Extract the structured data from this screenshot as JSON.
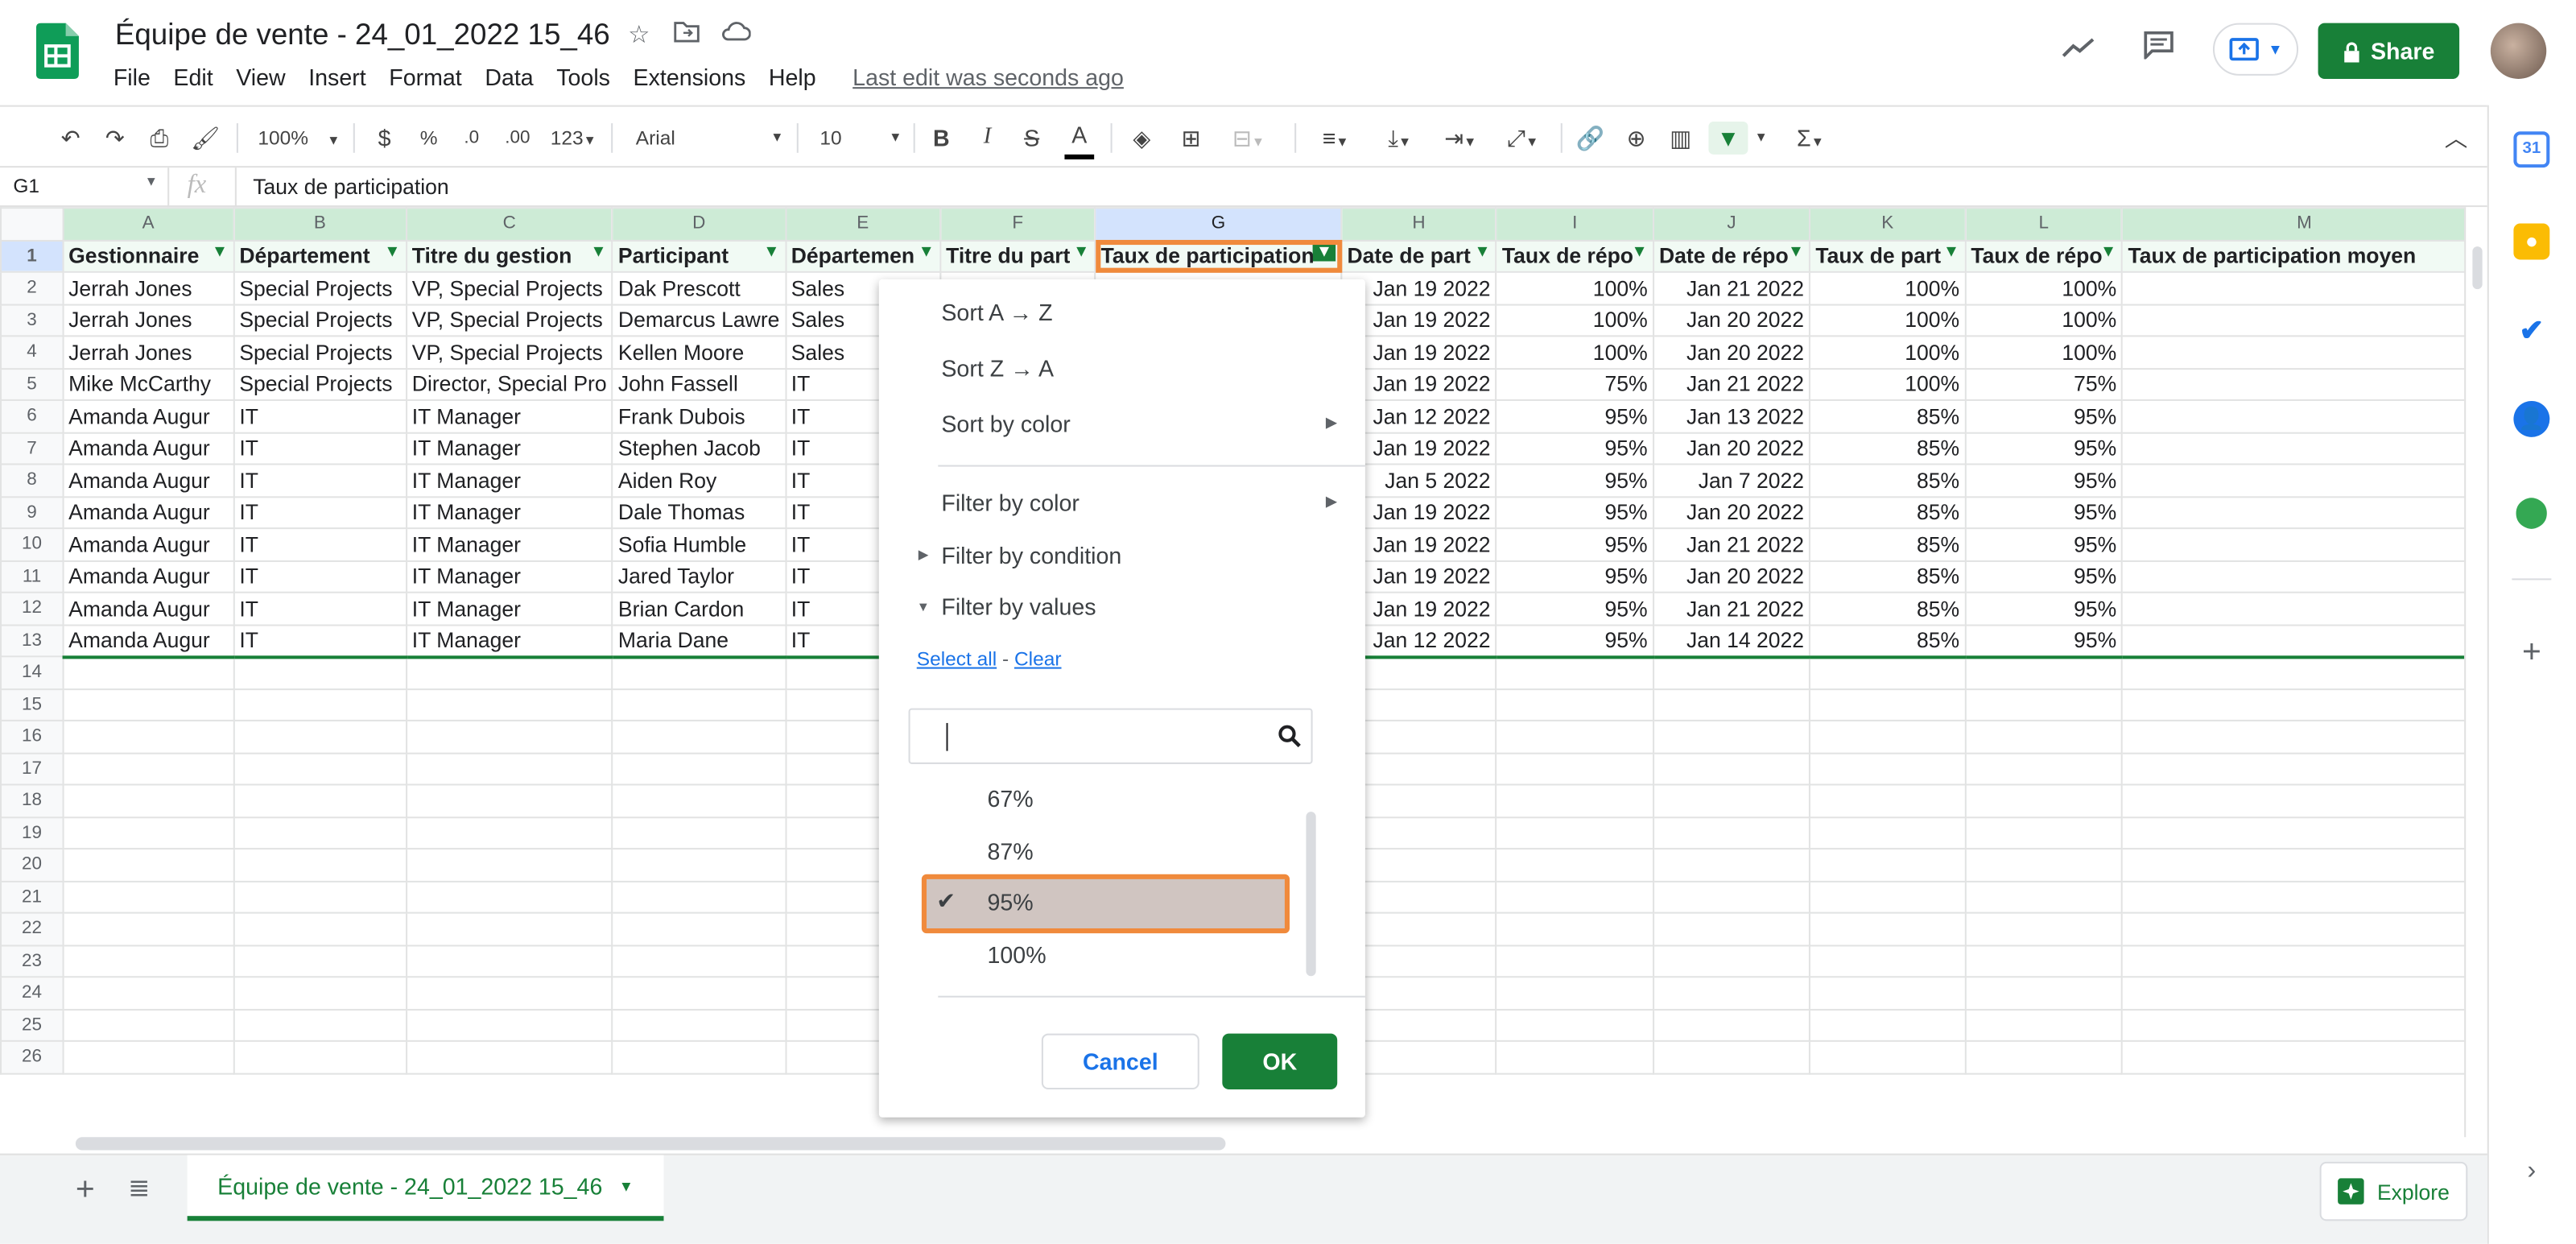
{
  "app": {
    "doc_title": "Équipe de vente - 24_01_2022 15_46",
    "menu": [
      "File",
      "Edit",
      "View",
      "Insert",
      "Format",
      "Data",
      "Tools",
      "Extensions",
      "Help"
    ],
    "last_edit": "Last edit was seconds ago",
    "share_label": "Share"
  },
  "toolbar": {
    "zoom": "100%",
    "currency": "$",
    "percent": "%",
    "dec_less": ".0",
    "dec_more": ".00",
    "format_more": "123",
    "font": "Arial",
    "font_size": "10",
    "bold": "B",
    "italic": "I",
    "strike": "S",
    "text_color": "A"
  },
  "formula_bar": {
    "cell_ref": "G1",
    "fx": "fx",
    "content": "Taux de participation"
  },
  "grid": {
    "columns": [
      "A",
      "B",
      "C",
      "D",
      "E",
      "F",
      "G",
      "H",
      "I",
      "J",
      "K",
      "L",
      "M"
    ],
    "header_row": [
      "Gestionnaire",
      "Département",
      "Titre du gestion",
      "Participant",
      "Départemen",
      "Titre du part",
      "Taux de participation",
      "Date de part",
      "Taux de répo",
      "Date de répo",
      "Taux de part",
      "Taux de répo",
      "Taux de participation moyen"
    ],
    "rows": [
      [
        "Jerrah Jones",
        "Special Projects",
        "VP, Special Projects",
        "Dak Prescott",
        "Sales",
        "",
        "",
        "Jan 19 2022",
        "100%",
        "Jan 21 2022",
        "100%",
        "100%",
        ""
      ],
      [
        "Jerrah Jones",
        "Special Projects",
        "VP, Special Projects",
        "Demarcus Lawre",
        "Sales",
        "",
        "",
        "Jan 19 2022",
        "100%",
        "Jan 20 2022",
        "100%",
        "100%",
        ""
      ],
      [
        "Jerrah Jones",
        "Special Projects",
        "VP, Special Projects",
        "Kellen Moore",
        "Sales",
        "",
        "",
        "Jan 19 2022",
        "100%",
        "Jan 20 2022",
        "100%",
        "100%",
        ""
      ],
      [
        "Mike McCarthy",
        "Special Projects",
        "Director, Special Pro",
        "John Fassell",
        "IT",
        "",
        "",
        "Jan 19 2022",
        "75%",
        "Jan 21 2022",
        "100%",
        "75%",
        ""
      ],
      [
        "Amanda Augur",
        "IT",
        "IT Manager",
        "Frank Dubois",
        "IT",
        "",
        "",
        "Jan 12 2022",
        "95%",
        "Jan 13 2022",
        "85%",
        "95%",
        ""
      ],
      [
        "Amanda Augur",
        "IT",
        "IT Manager",
        "Stephen Jacob",
        "IT",
        "",
        "",
        "Jan 19 2022",
        "95%",
        "Jan 20 2022",
        "85%",
        "95%",
        ""
      ],
      [
        "Amanda Augur",
        "IT",
        "IT Manager",
        "Aiden Roy",
        "IT",
        "",
        "",
        "Jan 5 2022",
        "95%",
        "Jan 7 2022",
        "85%",
        "95%",
        ""
      ],
      [
        "Amanda Augur",
        "IT",
        "IT Manager",
        "Dale Thomas",
        "IT",
        "",
        "",
        "Jan 19 2022",
        "95%",
        "Jan 20 2022",
        "85%",
        "95%",
        ""
      ],
      [
        "Amanda Augur",
        "IT",
        "IT Manager",
        "Sofia Humble",
        "IT",
        "",
        "",
        "Jan 19 2022",
        "95%",
        "Jan 21 2022",
        "85%",
        "95%",
        ""
      ],
      [
        "Amanda Augur",
        "IT",
        "IT Manager",
        "Jared Taylor",
        "IT",
        "",
        "",
        "Jan 19 2022",
        "95%",
        "Jan 20 2022",
        "85%",
        "95%",
        ""
      ],
      [
        "Amanda Augur",
        "IT",
        "IT Manager",
        "Brian Cardon",
        "IT",
        "",
        "",
        "Jan 19 2022",
        "95%",
        "Jan 21 2022",
        "85%",
        "95%",
        ""
      ],
      [
        "Amanda Augur",
        "IT",
        "IT Manager",
        "Maria Dane",
        "IT",
        "",
        "",
        "Jan 12 2022",
        "95%",
        "Jan 14 2022",
        "85%",
        "95%",
        ""
      ]
    ],
    "empty_row_numbers": [
      14,
      15,
      16,
      17,
      18,
      19,
      20,
      21,
      22,
      23,
      24,
      25,
      26
    ]
  },
  "filter_menu": {
    "sort_az": "Sort A → Z",
    "sort_za": "Sort Z → A",
    "sort_color": "Sort by color",
    "filter_color": "Filter by color",
    "filter_condition": "Filter by condition",
    "filter_values": "Filter by values",
    "select_all": "Select all",
    "clear": "Clear",
    "values": [
      {
        "label": "67%",
        "checked": false
      },
      {
        "label": "87%",
        "checked": false
      },
      {
        "label": "95%",
        "checked": true
      },
      {
        "label": "100%",
        "checked": false
      }
    ],
    "cancel": "Cancel",
    "ok": "OK"
  },
  "bottom": {
    "sheet_tab": "Équipe de vente - 24_01_2022 15_46",
    "explore": "Explore"
  },
  "colors": {
    "brand_green": "#188038",
    "highlight_orange": "#f08a3c",
    "link_blue": "#1a73e8"
  }
}
